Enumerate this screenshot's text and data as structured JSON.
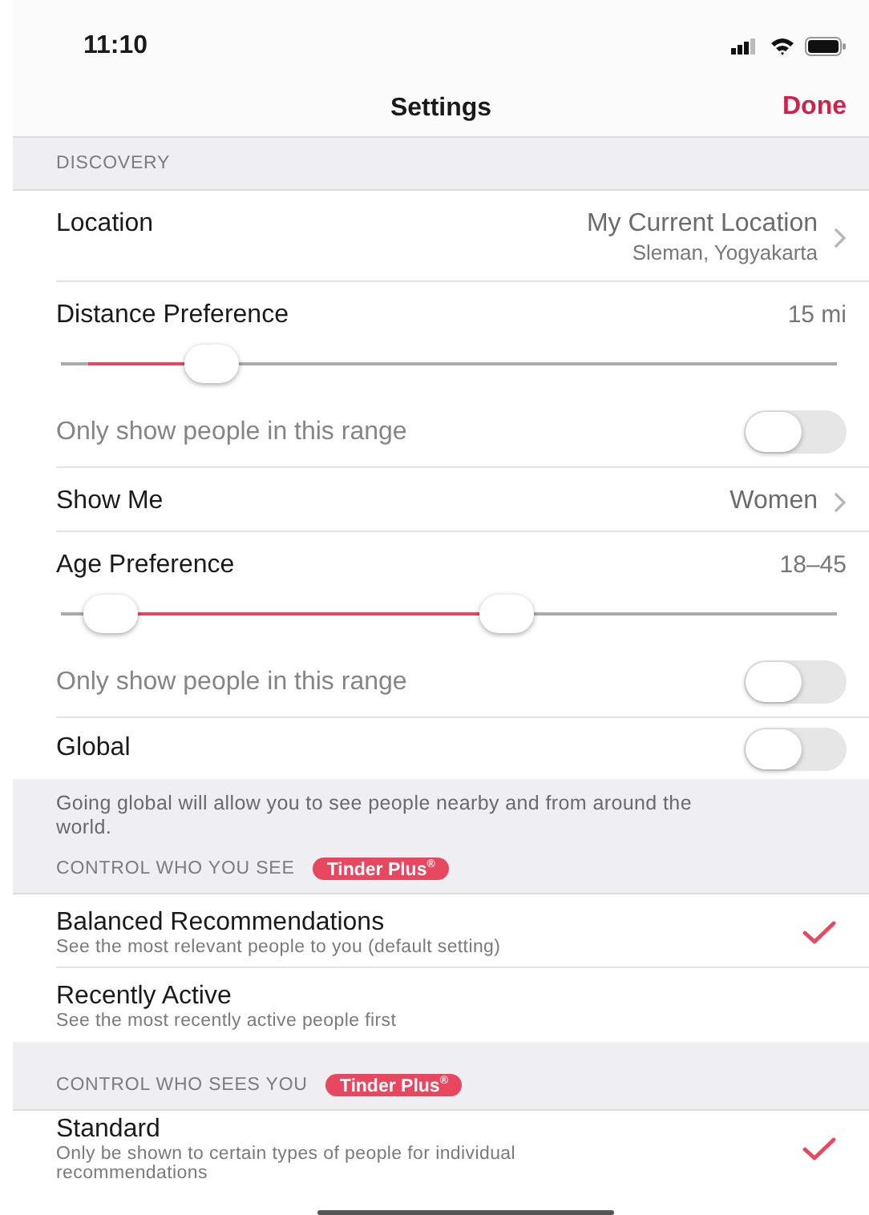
{
  "status_bar": {
    "time": "11:10"
  },
  "nav": {
    "title": "Settings",
    "action": "Done"
  },
  "sections": [
    {
      "header": "DISCOVERY",
      "rows": [
        {
          "kind": "link",
          "label": "Location",
          "value": "My Current Location",
          "detail": "Sleman, Yogyakarta"
        },
        {
          "kind": "slider",
          "label": "Distance Preference",
          "reading": "15 mi",
          "level": 0.17
        },
        {
          "kind": "filter-toggle",
          "label": "Only show people in this range",
          "on": false
        },
        {
          "kind": "link",
          "label": "Show Me",
          "value": "Women"
        },
        {
          "kind": "range",
          "label": "Age Preference",
          "reading": "18–45",
          "thumbs": [
            {
              "level": 0.03
            },
            {
              "level": 0.58
            }
          ]
        },
        {
          "kind": "filter-toggle",
          "label": "Only show people in this range",
          "on": false
        },
        {
          "kind": "toggle",
          "label": "Global",
          "on": false
        }
      ],
      "footer": "Going global will allow you to see people nearby and from around the world."
    },
    {
      "header": "CONTROL WHO YOU SEE",
      "badge": "Tinder Plus$^{®}$",
      "rows": [
        {
          "kind": "option",
          "title": "Balanced Recommendations",
          "subtitle": "See the most relevant people to you (default setting)",
          "selected": true
        },
        {
          "kind": "option",
          "title": "Recently Active",
          "subtitle": "See the most recently active people first",
          "selected": false
        }
      ]
    },
    {
      "header": "CONTROL WHO SEES YOU",
      "badge": "Tinder Plus$^{®}$",
      "rows": [
        {
          "kind": "option",
          "title": "Standard",
          "subtitle": "Only be shown to certain types of people for individual recommendations",
          "selected": true
        }
      ]
    }
  ]
}
